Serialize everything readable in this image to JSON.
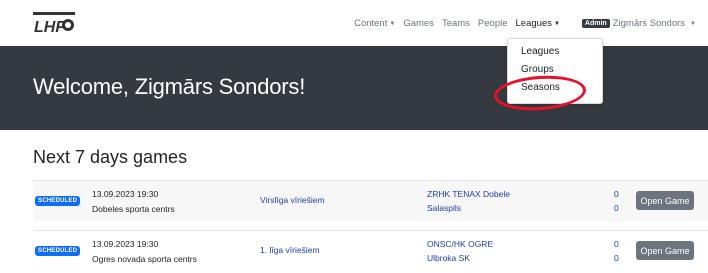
{
  "brand": {
    "logo_text": "LHF"
  },
  "nav": {
    "items": [
      {
        "label": "Content",
        "has_caret": true
      },
      {
        "label": "Games"
      },
      {
        "label": "Teams"
      },
      {
        "label": "People"
      },
      {
        "label": "Leagues",
        "has_caret": true,
        "active": true
      }
    ],
    "user": {
      "badge": "Admin",
      "name": "Zigmārs Sondors"
    }
  },
  "leagues_dropdown": {
    "items": [
      "Leagues",
      "Groups",
      "Seasons"
    ]
  },
  "hero": {
    "title": "Welcome, Zigmārs Sondors!"
  },
  "games_section": {
    "title": "Next 7 days games",
    "button_label": "Open Game",
    "rows": [
      {
        "status": "SCHEDULED",
        "datetime": "13.09.2023 19:30",
        "venue": "Dobeles sporta centrs",
        "league": "Virslīga vīriešiem",
        "home_team": "ZRHK TENAX Dobele",
        "away_team": "Salaspils",
        "home_score": "0",
        "away_score": "0"
      },
      {
        "status": "SCHEDULED",
        "datetime": "13.09.2023 19:30",
        "venue": "Ogres novada sporta centrs",
        "league": "1. līga vīriešiem",
        "home_team": "ONSC/HK OGRE",
        "away_team": "Ulbroka SK",
        "home_score": "0",
        "away_score": "0"
      }
    ]
  },
  "colors": {
    "hero_bg": "#343a40",
    "status_badge": "#0d6efd",
    "link": "#1a3fb0",
    "button": "#6c757d",
    "annotation": "#e8102a"
  },
  "icons": {
    "caret": "caret-down-icon"
  }
}
